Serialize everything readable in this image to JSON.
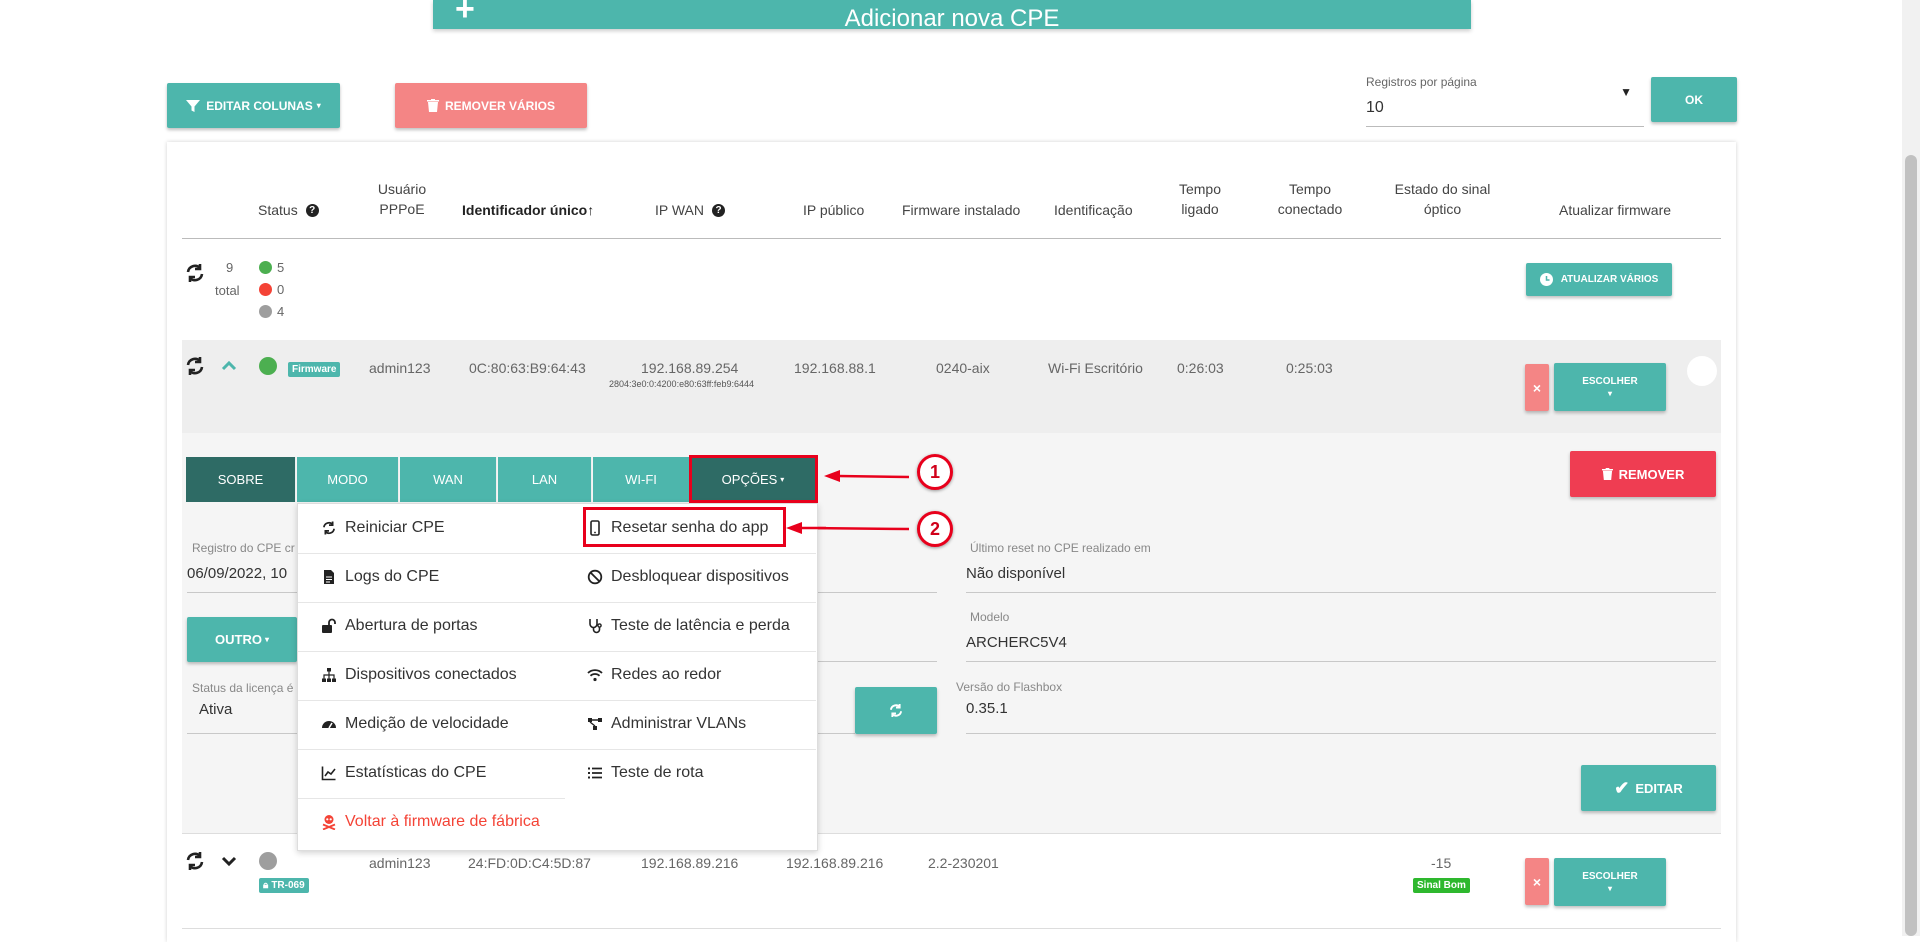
{
  "top_button": {
    "label": "Adicionar nova CPE"
  },
  "toolbar": {
    "edit_columns": "EDITAR COLUNAS",
    "remove_many": "REMOVER VÁRIOS",
    "per_page_label": "Registros por página",
    "per_page_value": "10",
    "ok": "OK"
  },
  "table": {
    "headers": {
      "status": "Status",
      "pppoe_1": "Usuário",
      "pppoe_2": "PPPoE",
      "unique_id": "Identificador único↑",
      "ip_wan": "IP WAN",
      "ip_public": "IP público",
      "firmware": "Firmware instalado",
      "identification": "Identificação",
      "uptime_1": "Tempo",
      "uptime_2": "ligado",
      "conn_1": "Tempo",
      "conn_2": "conectado",
      "signal_1": "Estado do sinal",
      "signal_2": "óptico",
      "update_fw": "Atualizar firmware"
    },
    "summary": {
      "total_num": "9",
      "total_label": "total",
      "green": "5",
      "red": "0",
      "gray": "4",
      "update_many": "ATUALIZAR VÁRIOS"
    },
    "row1": {
      "badge": "Firmware",
      "pppoe": "admin123",
      "id": "0C:80:63:B9:64:43",
      "ip_wan": "192.168.89.254",
      "ip_wan_v6": "2804:3e0:0:4200:e80:63ff:feb9:6444",
      "ip_public": "192.168.88.1",
      "firmware": "0240-aix",
      "identification": "Wi-Fi Escritório",
      "uptime": "0:26:03",
      "connected": "0:25:03",
      "choose": "ESCOLHER",
      "close": "×"
    },
    "row2": {
      "badge": "TR-069",
      "pppoe": "admin123",
      "id": "24:FD:0D:C4:5D:87",
      "ip_wan": "192.168.89.216",
      "ip_public": "192.168.89.216",
      "firmware": "2.2-230201",
      "signal": "-15",
      "signal_badge": "Sinal Bom",
      "choose": "ESCOLHER",
      "close": "×"
    }
  },
  "details": {
    "tabs": [
      "SOBRE",
      "MODO",
      "WAN",
      "LAN",
      "WI-FI",
      "OPÇÕES"
    ],
    "remove": "REMOVER",
    "reg_label": "Registro do CPE cr",
    "reg_value": "06/09/2022, 10",
    "other": "OUTRO",
    "license_label": "Status da licença é",
    "license_value": "Ativa",
    "last_reset_label": "Último reset no CPE realizado em",
    "last_reset_value": "Não disponível",
    "model_label": "Modelo",
    "model_value": "ARCHERC5V4",
    "flashbox_label": "Versão do Flashbox",
    "flashbox_value": "0.35.1",
    "edit": "EDITAR"
  },
  "menu": {
    "restart": "Reiniciar CPE",
    "reset_app_pwd": "Resetar senha do app",
    "logs": "Logs do CPE",
    "unblock": "Desbloquear dispositivos",
    "ports": "Abertura de portas",
    "latency": "Teste de latência e perda",
    "devices": "Dispositivos conectados",
    "nearby": "Redes ao redor",
    "speed": "Medição de velocidade",
    "vlans": "Administrar VLANs",
    "stats": "Estatísticas do CPE",
    "route": "Teste de rota",
    "factory": "Voltar à firmware de fábrica"
  },
  "annotations": {
    "one": "1",
    "two": "2"
  },
  "colors": {
    "teal": "#4db6ac",
    "dark_teal": "#2e6b65",
    "pink": "#f48585",
    "red": "#ef3d52",
    "annotation": "#e8001c",
    "green": "#4caf50"
  }
}
